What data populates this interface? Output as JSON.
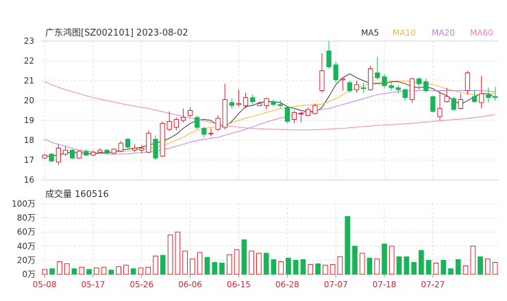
{
  "header": {
    "title": "广东鸿图[SZ002101] 2023-08-02",
    "ma_labels": [
      {
        "label": "MA5",
        "color": "#333333"
      },
      {
        "label": "MA10",
        "color": "#f7b733"
      },
      {
        "label": "MA20",
        "color": "#c57ee8"
      },
      {
        "label": "MA60",
        "color": "#f47fbf"
      }
    ]
  },
  "volume_panel": {
    "title": "成交量 160516"
  },
  "colors": {
    "up": "#e0212e",
    "down": "#19b35a"
  },
  "chart_data": [
    {
      "type": "candlestick",
      "title": "广东鸿图[SZ002101] 2023-08-02",
      "ylim": [
        16,
        23
      ],
      "yticks": [
        "16",
        "17",
        "18",
        "19",
        "20",
        "21",
        "22",
        "23"
      ],
      "grid": true,
      "xtick_labels": [
        {
          "i": 0,
          "label": "05-08"
        },
        {
          "i": 7,
          "label": "05-17"
        },
        {
          "i": 14,
          "label": "05-26"
        },
        {
          "i": 21,
          "label": "06-06"
        },
        {
          "i": 28,
          "label": "06-15"
        },
        {
          "i": 35,
          "label": "06-28"
        },
        {
          "i": 42,
          "label": "07-07"
        },
        {
          "i": 49,
          "label": "07-18"
        },
        {
          "i": 56,
          "label": "07-27"
        }
      ],
      "candles": [
        [
          17.1,
          17.25,
          17.3,
          17.05
        ],
        [
          17.3,
          16.95,
          17.35,
          16.9
        ],
        [
          16.9,
          17.6,
          17.8,
          16.75
        ],
        [
          17.3,
          17.5,
          17.7,
          17.2
        ],
        [
          17.5,
          17.1,
          17.55,
          17.05
        ],
        [
          17.1,
          17.45,
          17.5,
          17.05
        ],
        [
          17.45,
          17.25,
          17.55,
          17.2
        ],
        [
          17.25,
          17.4,
          17.5,
          17.2
        ],
        [
          17.4,
          17.5,
          17.6,
          17.35
        ],
        [
          17.5,
          17.35,
          17.55,
          17.3
        ],
        [
          17.35,
          17.55,
          17.6,
          17.3
        ],
        [
          17.45,
          17.85,
          17.95,
          17.4
        ],
        [
          18.05,
          17.65,
          18.1,
          17.6
        ],
        [
          17.5,
          17.6,
          17.8,
          17.4
        ],
        [
          17.5,
          17.6,
          17.75,
          17.35
        ],
        [
          17.4,
          18.35,
          18.5,
          17.35
        ],
        [
          18.05,
          17.1,
          18.25,
          17.0
        ],
        [
          17.2,
          18.85,
          18.95,
          17.15
        ],
        [
          18.55,
          18.95,
          19.45,
          18.45
        ],
        [
          18.65,
          19.05,
          19.15,
          18.5
        ],
        [
          19.0,
          19.15,
          19.6,
          18.9
        ],
        [
          19.25,
          19.5,
          19.65,
          19.15
        ],
        [
          19.15,
          18.65,
          19.25,
          18.55
        ],
        [
          18.6,
          18.3,
          18.7,
          18.15
        ],
        [
          18.35,
          18.35,
          18.6,
          18.2
        ],
        [
          18.55,
          19.1,
          19.25,
          18.45
        ],
        [
          18.65,
          20.05,
          20.85,
          18.55
        ],
        [
          19.9,
          19.75,
          20.1,
          19.6
        ],
        [
          19.8,
          19.85,
          20.55,
          19.7
        ],
        [
          19.75,
          20.15,
          20.4,
          19.6
        ],
        [
          20.15,
          19.95,
          20.3,
          19.75
        ],
        [
          19.75,
          19.85,
          19.95,
          19.75
        ],
        [
          19.75,
          20.1,
          20.15,
          19.55
        ],
        [
          19.95,
          19.8,
          20.05,
          19.7
        ],
        [
          19.8,
          19.75,
          20.0,
          19.6
        ],
        [
          19.65,
          18.95,
          19.7,
          18.85
        ],
        [
          19.05,
          19.4,
          19.5,
          18.85
        ],
        [
          19.35,
          19.35,
          19.45,
          18.9
        ],
        [
          19.25,
          19.55,
          19.65,
          19.2
        ],
        [
          19.35,
          19.75,
          19.85,
          19.3
        ],
        [
          20.5,
          21.5,
          22.4,
          20.4
        ],
        [
          22.5,
          21.7,
          23.0,
          21.6
        ],
        [
          21.8,
          21.05,
          21.95,
          20.9
        ],
        [
          21.05,
          21.1,
          21.15,
          20.5
        ],
        [
          20.9,
          20.5,
          21.0,
          20.4
        ],
        [
          20.55,
          20.8,
          21.0,
          20.4
        ],
        [
          20.65,
          20.6,
          20.9,
          20.4
        ],
        [
          20.55,
          21.6,
          21.75,
          20.5
        ],
        [
          21.4,
          21.15,
          22.2,
          21.05
        ],
        [
          21.2,
          20.75,
          21.35,
          20.6
        ],
        [
          20.75,
          20.65,
          20.95,
          20.5
        ],
        [
          20.65,
          20.55,
          20.8,
          20.35
        ],
        [
          20.55,
          20.15,
          20.6,
          20.0
        ],
        [
          20.05,
          21.1,
          21.15,
          19.9
        ],
        [
          21.1,
          20.85,
          21.15,
          20.55
        ],
        [
          20.95,
          20.5,
          21.1,
          20.4
        ],
        [
          20.2,
          19.45,
          20.25,
          19.4
        ],
        [
          19.2,
          19.6,
          20.45,
          19.0
        ],
        [
          19.95,
          20.2,
          20.65,
          19.9
        ],
        [
          20.1,
          19.55,
          20.2,
          19.5
        ],
        [
          19.6,
          20.05,
          20.35,
          19.55
        ],
        [
          20.5,
          21.4,
          21.5,
          20.3
        ],
        [
          20.2,
          19.95,
          20.55,
          19.9
        ],
        [
          19.9,
          20.35,
          21.25,
          19.6
        ],
        [
          20.3,
          20.15,
          20.65,
          19.9
        ],
        [
          20.2,
          20.15,
          20.7,
          20.0
        ]
      ],
      "series": [
        {
          "name": "MA5",
          "color": "#333333",
          "values": [
            17.2,
            17.2,
            17.25,
            17.35,
            17.4,
            17.35,
            17.35,
            17.3,
            17.35,
            17.4,
            17.4,
            17.5,
            17.55,
            17.6,
            17.65,
            17.75,
            17.85,
            17.95,
            18.1,
            18.3,
            18.6,
            18.85,
            19.0,
            19.05,
            19.0,
            18.75,
            18.7,
            18.95,
            19.35,
            19.7,
            19.75,
            19.9,
            19.95,
            19.95,
            19.9,
            19.7,
            19.6,
            19.5,
            19.45,
            19.4,
            19.65,
            20.2,
            20.8,
            21.15,
            21.35,
            21.15,
            21.0,
            20.85,
            20.85,
            20.85,
            20.95,
            20.95,
            20.85,
            20.7,
            20.65,
            20.7,
            20.6,
            20.4,
            20.25,
            20.0,
            19.8,
            20.0,
            20.2,
            20.35,
            20.35,
            20.15
          ]
        },
        {
          "name": "MA10",
          "color": "#f7b733",
          "values": [
            null,
            null,
            null,
            null,
            null,
            null,
            null,
            null,
            null,
            17.35,
            17.4,
            17.42,
            17.45,
            17.5,
            17.55,
            17.58,
            17.65,
            17.75,
            17.85,
            18.0,
            18.15,
            18.35,
            18.5,
            18.6,
            18.65,
            18.7,
            18.78,
            18.88,
            19.0,
            19.12,
            19.2,
            19.3,
            19.4,
            19.5,
            19.6,
            19.65,
            19.7,
            19.75,
            19.78,
            19.8,
            19.82,
            19.95,
            20.1,
            20.3,
            20.5,
            20.65,
            20.75,
            20.85,
            20.9,
            20.95,
            21.0,
            21.0,
            20.98,
            20.95,
            20.9,
            20.85,
            20.8,
            20.7,
            20.6,
            20.5,
            20.4,
            20.35,
            20.3,
            20.3,
            20.35,
            20.35
          ]
        },
        {
          "name": "MA20",
          "color": "#c57ee8",
          "values": [
            18.05,
            17.9,
            17.8,
            17.7,
            17.6,
            17.5,
            17.45,
            17.4,
            17.35,
            17.3,
            17.3,
            17.3,
            17.32,
            17.35,
            17.38,
            17.4,
            17.45,
            17.52,
            17.6,
            17.7,
            17.8,
            17.9,
            17.98,
            18.05,
            18.1,
            18.15,
            18.25,
            18.35,
            18.45,
            18.55,
            18.68,
            18.8,
            18.92,
            19.02,
            19.12,
            19.2,
            19.3,
            19.38,
            19.45,
            19.5,
            19.55,
            19.6,
            19.7,
            19.8,
            19.9,
            20.0,
            20.1,
            20.2,
            20.3,
            20.35,
            20.4,
            20.45,
            20.48,
            20.5,
            20.5,
            20.52,
            20.5,
            20.5,
            20.5,
            20.5,
            20.5,
            20.5,
            20.5,
            20.5,
            20.48,
            20.45
          ]
        },
        {
          "name": "MA60",
          "color": "#f47fbf",
          "values": [
            20.95,
            20.8,
            20.67,
            20.55,
            20.45,
            20.35,
            20.25,
            20.15,
            20.08,
            20.0,
            19.92,
            19.85,
            19.78,
            19.72,
            19.66,
            19.6,
            19.52,
            19.44,
            19.36,
            19.28,
            19.2,
            19.12,
            19.05,
            18.98,
            18.9,
            18.82,
            18.75,
            18.7,
            18.66,
            18.62,
            18.6,
            18.58,
            18.56,
            18.55,
            18.54,
            18.53,
            18.52,
            18.52,
            18.52,
            18.53,
            18.54,
            18.56,
            18.58,
            18.6,
            18.63,
            18.66,
            18.69,
            18.72,
            18.75,
            18.77,
            18.79,
            18.81,
            18.83,
            18.86,
            18.89,
            18.92,
            18.95,
            18.98,
            19.01,
            19.04,
            19.07,
            19.1,
            19.14,
            19.18,
            19.24,
            19.3
          ]
        }
      ]
    },
    {
      "type": "bar",
      "title": "成交量 160516",
      "unit": "万",
      "ylim": [
        0,
        100
      ],
      "ytick_labels": [
        "0万",
        "20万",
        "40万",
        "60万",
        "80万",
        "100万"
      ],
      "values": [
        7,
        8,
        18,
        15,
        8,
        10,
        7,
        9,
        10,
        6,
        11,
        13,
        8,
        9,
        10,
        26,
        27,
        56,
        60,
        33,
        22,
        31,
        24,
        17,
        16,
        28,
        35,
        49,
        33,
        30,
        30,
        21,
        18,
        23,
        20,
        21,
        14,
        15,
        13,
        14,
        25,
        82,
        40,
        30,
        23,
        22,
        43,
        40,
        25,
        25,
        17,
        34,
        20,
        16,
        20,
        8,
        21,
        12,
        40,
        25,
        22,
        17
      ],
      "up": [
        1,
        0,
        1,
        1,
        0,
        1,
        0,
        1,
        1,
        0,
        1,
        1,
        0,
        1,
        1,
        1,
        0,
        1,
        1,
        1,
        1,
        1,
        0,
        0,
        0,
        1,
        1,
        0,
        1,
        1,
        0,
        0,
        1,
        0,
        0,
        0,
        1,
        0,
        1,
        1,
        1,
        0,
        0,
        1,
        0,
        1,
        0,
        1,
        0,
        0,
        0,
        0,
        0,
        1,
        0,
        0,
        0,
        1,
        1,
        0,
        1,
        1,
        0
      ]
    }
  ]
}
